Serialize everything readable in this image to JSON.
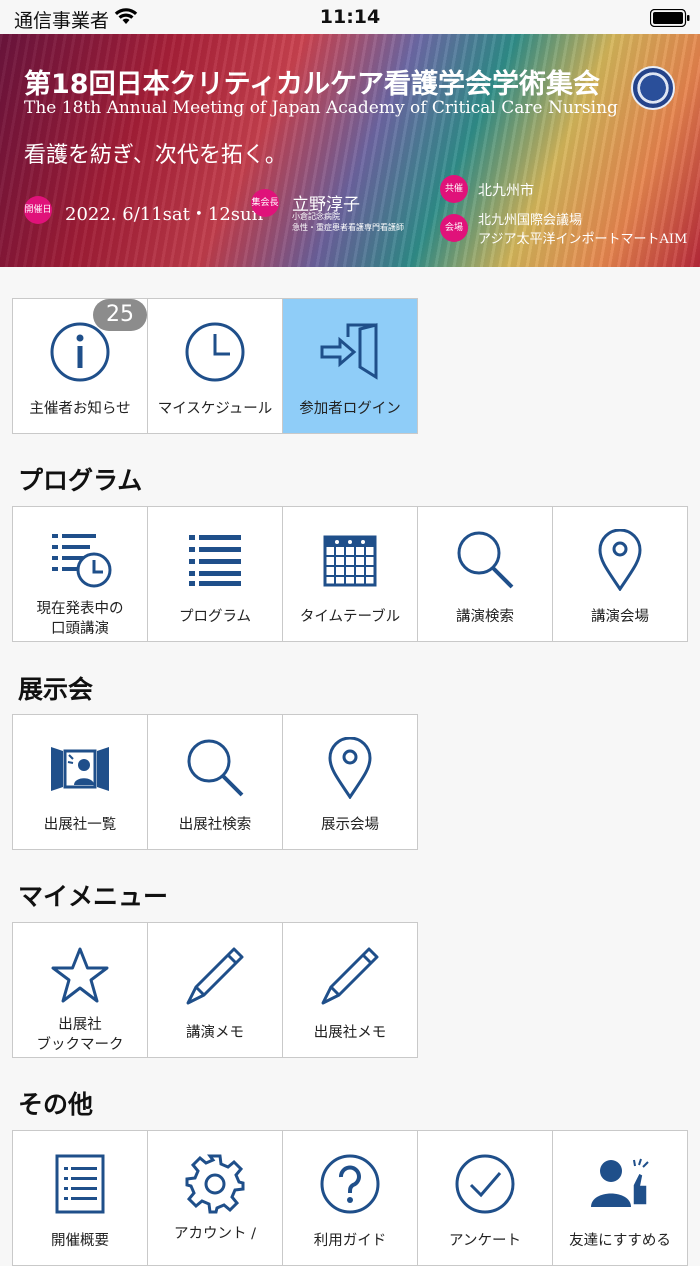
{
  "status_bar": {
    "carrier": "通信事業者",
    "time": "11:14"
  },
  "banner": {
    "title": "第18回日本クリティカルケア看護学会学術集会",
    "subtitle": "The 18th Annual Meeting of Japan Academy of Critical Care Nursing",
    "catchphrase": "看護を紡ぎ、次代を拓く。",
    "date_tag": "開催日",
    "date": "2022. 6/11sat・12sun",
    "chair_tag": "集会長",
    "chair_name": "立野淳子",
    "chair_aff1": "小倉記念病院",
    "chair_aff2": "急性・重症患者看護専門看護師",
    "host_tag": "共催",
    "host": "北九州市",
    "venue_tag": "会場",
    "venue1": "北九州国際会議場",
    "venue2": "アジア太平洋インポートマートAIM"
  },
  "top": {
    "notice_label": "主催者お知らせ",
    "notice_badge": "25",
    "schedule_label": "マイスケジュール",
    "login_label": "参加者ログイン"
  },
  "program": {
    "heading": "プログラム",
    "now_line1": "現在発表中の",
    "now_line2": "口頭講演",
    "program_label": "プログラム",
    "timetable_label": "タイムテーブル",
    "search_label": "講演検索",
    "venue_label": "講演会場"
  },
  "exhibition": {
    "heading": "展示会",
    "list_label": "出展社一覧",
    "search_label": "出展社検索",
    "venue_label": "展示会場"
  },
  "mymenu": {
    "heading": "マイメニュー",
    "bookmark_line1": "出展社",
    "bookmark_line2": "ブックマーク",
    "talk_memo_label": "講演メモ",
    "exhibitor_memo_label": "出展社メモ"
  },
  "other": {
    "heading": "その他",
    "overview_label": "開催概要",
    "account_label": "アカウント /",
    "guide_label": "利用ガイド",
    "survey_label": "アンケート",
    "recommend_label": "友達にすすめる"
  },
  "colors": {
    "icon": "#1f4f8a",
    "active_tile": "#8fcdf8",
    "badge": "#8c8c8c",
    "tag": "#e0127a"
  }
}
